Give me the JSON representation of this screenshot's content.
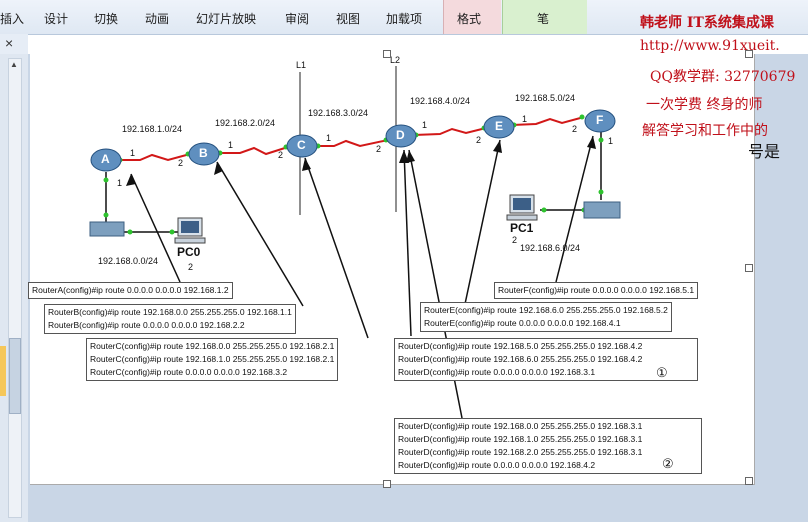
{
  "ribbon": {
    "tabs": [
      "插入",
      "设计",
      "切换",
      "动画",
      "幻灯片放映",
      "审阅",
      "视图",
      "加载项",
      "格式",
      "笔"
    ]
  },
  "pane": {
    "close": "×",
    "scroll_up": "▲"
  },
  "watermark": {
    "line1": "韩老师 IT系统集成课",
    "line2": "http://www.91xueit.",
    "line3": "QQ教学群: 32770679",
    "line4": "一次学费  终身的师",
    "line5": "解答学习和工作中的",
    "partial": "号是"
  },
  "diagram": {
    "lines": {
      "l1": "L1",
      "l2": "L2"
    },
    "routers": [
      "A",
      "B",
      "C",
      "D",
      "E",
      "F"
    ],
    "networks": {
      "n1": "192.168.1.0/24",
      "n2": "192.168.2.0/24",
      "n3": "192.168.3.0/24",
      "n4": "192.168.4.0/24",
      "n5": "192.168.5.0/24",
      "n6": "192.168.6.0/24",
      "n0": "192.168.0.0/24"
    },
    "ports": {
      "one": "1",
      "two": "2"
    },
    "pcs": {
      "pc0": "PC0",
      "pc1": "PC1"
    },
    "commands": {
      "a": [
        "RouterA(config)#ip route 0.0.0.0 0.0.0.0 192.168.1.2"
      ],
      "b": [
        "RouterB(config)#ip route 192.168.0.0 255.255.255.0 192.168.1.1",
        "RouterB(config)#ip route 0.0.0.0 0.0.0.0 192.168.2.2"
      ],
      "c": [
        "RouterC(config)#ip route 192.168.0.0 255.255.255.0 192.168.2.1",
        "RouterC(config)#ip route 192.168.1.0 255.255.255.0 192.168.2.1",
        "RouterC(config)#ip route 0.0.0.0 0.0.0.0 192.168.3.2"
      ],
      "d1": [
        "RouterD(config)#ip route 192.168.5.0 255.255.255.0 192.168.4.2",
        "RouterD(config)#ip route 192.168.6.0 255.255.255.0 192.168.4.2",
        "RouterD(config)#ip route 0.0.0.0 0.0.0.0 192.168.3.1"
      ],
      "d2": [
        "RouterD(config)#ip route 192.168.0.0 255.255.255.0 192.168.3.1",
        "RouterD(config)#ip route 192.168.1.0 255.255.255.0 192.168.3.1",
        "RouterD(config)#ip route 192.168.2.0 255.255.255.0 192.168.3.1",
        "RouterD(config)#ip route 0.0.0.0 0.0.0.0 192.168.4.2"
      ],
      "e": [
        "RouterE(config)#ip route 192.168.6.0 255.255.255.0 192.168.5.2",
        "RouterE(config)#ip route 0.0.0.0 0.0.0.0 192.168.4.1"
      ],
      "f": [
        "RouterF(config)#ip route 0.0.0.0 0.0.0.0 192.168.5.1"
      ]
    },
    "markers": {
      "m1": "①",
      "m2": "②"
    }
  }
}
